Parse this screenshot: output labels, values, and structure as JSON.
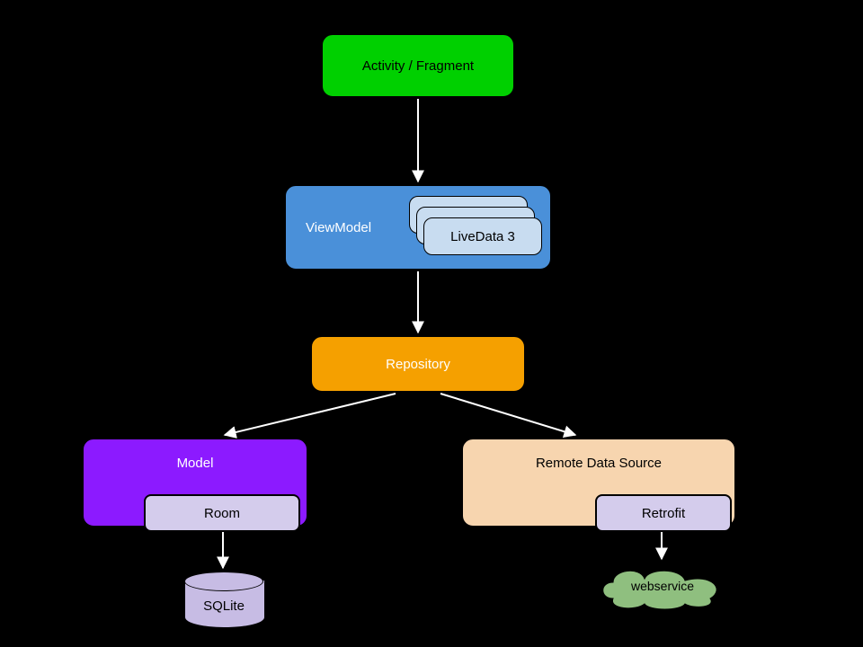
{
  "nodes": {
    "activity": "Activity / Fragment",
    "viewmodel": "ViewModel",
    "livedata": "LiveData 3",
    "repository": "Repository",
    "model": "Model",
    "room": "Room",
    "remote": "Remote Data Source",
    "retrofit": "Retrofit",
    "sqlite": "SQLite",
    "webservice": "webservice"
  },
  "colors": {
    "activity": "#00d000",
    "viewmodel": "#4a90d9",
    "livedata": "#c8dcf0",
    "repository": "#f5a000",
    "model": "#8c1aff",
    "sub": "#d4ccec",
    "remote": "#f7d5af",
    "cylinder": "#c7bce4",
    "cloud": "#8fbf7f"
  },
  "edges": [
    {
      "from": "activity",
      "to": "viewmodel"
    },
    {
      "from": "viewmodel",
      "to": "repository"
    },
    {
      "from": "repository",
      "to": "model"
    },
    {
      "from": "repository",
      "to": "remote"
    },
    {
      "from": "room",
      "to": "sqlite"
    },
    {
      "from": "retrofit",
      "to": "webservice"
    }
  ]
}
